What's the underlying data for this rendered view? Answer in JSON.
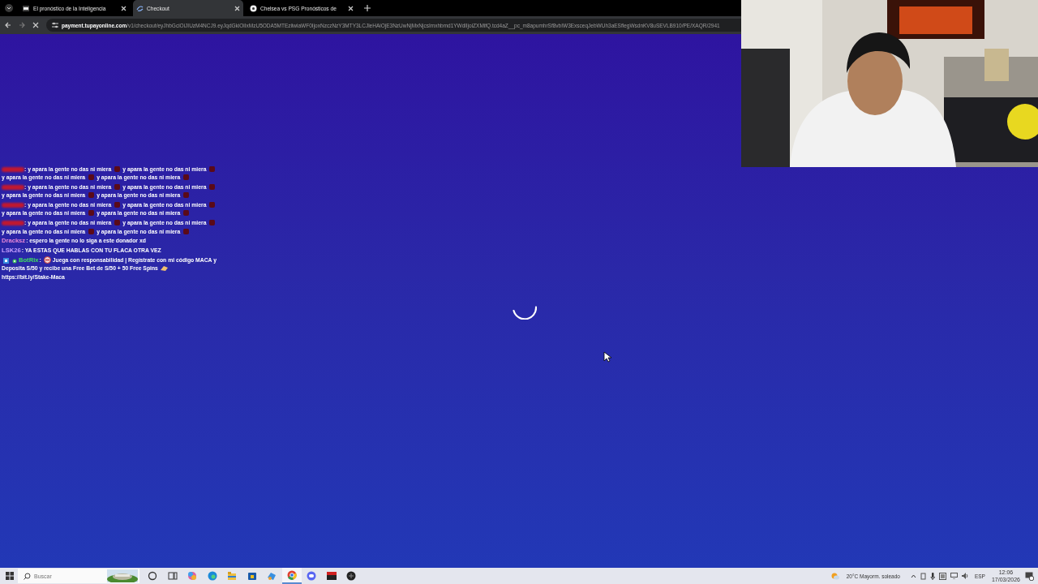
{
  "browser": {
    "tabs": [
      {
        "title": "El pronóstico de la Inteligencia",
        "selected": false,
        "kind": "si"
      },
      {
        "title": "Checkout",
        "selected": true,
        "kind": "pay"
      },
      {
        "title": "Chelsea vs PSG Pronósticos de",
        "selected": false,
        "kind": "ball"
      }
    ],
    "url": {
      "domain": "payment.tupayonline.com",
      "path": "/v1/checkout/eyJhbGciOiJIUzM4NCJ9.eyJqdGkiOiIxMzU5ODA5MTEziiwiaWF0IjoxNzczNzY3MTY3LCJleHAiOjE3NzUwNjMxNjcsImxhbmd1YWdlIjoiZXMifQ.tcd4aZ__pc_m8apumhrSf8vbIW3ExsceqJebWUh3aESflegWsdnKV8uSEVLB910/PE/XAQR/2941"
    },
    "loading": true
  },
  "chat": {
    "messages": [
      {
        "kind": "blurred",
        "color": "#c01830",
        "segments": [
          {
            "kind": "text",
            "text": ": y apara la gente no das ni miera"
          },
          {
            "kind": "emote"
          },
          {
            "kind": "text",
            "text": "y apara la gente no das ni miera"
          },
          {
            "kind": "emote"
          },
          {
            "kind": "text",
            "text": "y apara la gente no das ni miera"
          },
          {
            "kind": "emote"
          },
          {
            "kind": "text",
            "text": "y apara la gente no das ni miera"
          },
          {
            "kind": "emote"
          }
        ]
      },
      {
        "kind": "blurred",
        "color": "#c01830",
        "segments": [
          {
            "kind": "text",
            "text": ": y apara la gente no das ni miera"
          },
          {
            "kind": "emote"
          },
          {
            "kind": "text",
            "text": "y apara la gente no das ni miera"
          },
          {
            "kind": "emote"
          },
          {
            "kind": "text",
            "text": "y apara la gente no das ni miera"
          },
          {
            "kind": "emote"
          },
          {
            "kind": "text",
            "text": "y apara la gente no das ni miera"
          },
          {
            "kind": "emote"
          }
        ]
      },
      {
        "kind": "blurred",
        "color": "#c01830",
        "segments": [
          {
            "kind": "text",
            "text": ": y apara la gente no das ni miera"
          },
          {
            "kind": "emote"
          },
          {
            "kind": "text",
            "text": "y apara la gente no das ni miera"
          },
          {
            "kind": "emote"
          },
          {
            "kind": "text",
            "text": "y apara la gente no das ni miera"
          },
          {
            "kind": "emote"
          },
          {
            "kind": "text",
            "text": "y apara la gente no das ni miera"
          },
          {
            "kind": "emote"
          }
        ]
      },
      {
        "kind": "blurred",
        "color": "#c01830",
        "segments": [
          {
            "kind": "text",
            "text": ": y apara la gente no das ni miera"
          },
          {
            "kind": "emote"
          },
          {
            "kind": "text",
            "text": "y apara la gente no das ni miera"
          },
          {
            "kind": "emote"
          },
          {
            "kind": "text",
            "text": "y apara la gente no das ni miera"
          },
          {
            "kind": "emote"
          },
          {
            "kind": "text",
            "text": "y apara la gente no das ni miera"
          },
          {
            "kind": "emote"
          }
        ]
      },
      {
        "kind": "named",
        "user": "Dracksz",
        "color": "#e888d8",
        "segments": [
          {
            "kind": "text",
            "text": ": espero la gente no lo siga a este donador xd"
          }
        ]
      },
      {
        "kind": "named",
        "user": "LSK26",
        "color": "#c8a0ff",
        "segments": [
          {
            "kind": "text",
            "text": ": YA ESTAS QUE HABLAS CON TU FLACA OTRA VEZ"
          }
        ]
      },
      {
        "kind": "bot",
        "user": "BotRix",
        "color": "#40e060",
        "segments": [
          {
            "kind": "text",
            "text": ":"
          },
          {
            "kind": "noentry"
          },
          {
            "kind": "text",
            "text": "Juega con responsabilidad | Regístrate con mi código MACA y"
          },
          {
            "kind": "text",
            "text": "Deposita S/50 y recibe una Free Bet de S/50 + 50 Free Spins"
          },
          {
            "kind": "hand"
          },
          {
            "kind": "link",
            "text": "https://bit.ly/Stake-Maca"
          }
        ]
      }
    ]
  },
  "taskbar": {
    "search_placeholder": "Buscar",
    "apps": [
      {
        "kind": "cortana",
        "selected": false
      },
      {
        "kind": "taskview",
        "selected": false
      },
      {
        "kind": "copilot",
        "selected": false
      },
      {
        "kind": "edge",
        "selected": false
      },
      {
        "kind": "folder",
        "selected": false
      },
      {
        "kind": "store",
        "selected": false
      },
      {
        "kind": "paint",
        "selected": false
      },
      {
        "kind": "chrome",
        "selected": true
      },
      {
        "kind": "discord",
        "selected": false
      },
      {
        "kind": "redapp",
        "selected": false
      },
      {
        "kind": "darkapp",
        "selected": false
      }
    ],
    "weather": "20°C  Mayorm. soleado",
    "language": "ESP",
    "time": "12:06",
    "date": "17/03/2026"
  }
}
